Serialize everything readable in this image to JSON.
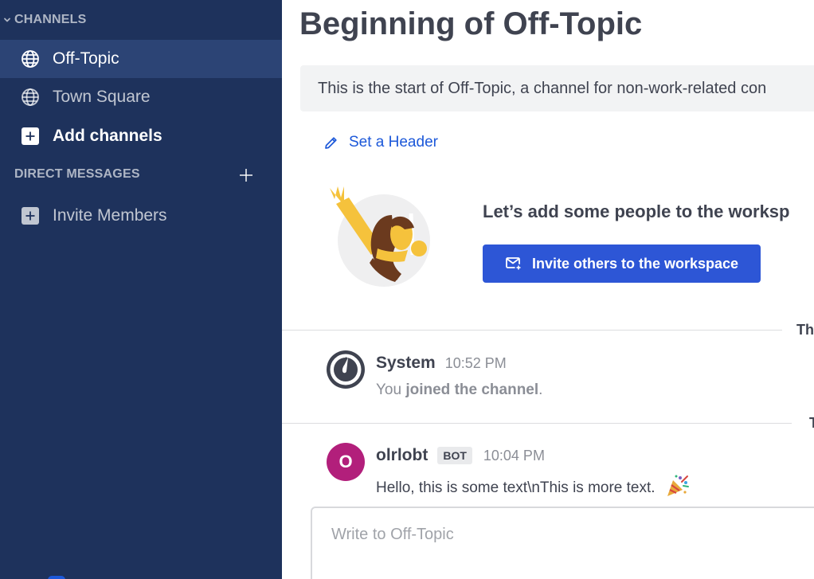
{
  "sidebar": {
    "channels_header": "CHANNELS",
    "channels": [
      {
        "label": "Off-Topic",
        "icon": "globe-icon",
        "active": true
      },
      {
        "label": "Town Square",
        "icon": "globe-icon",
        "active": false
      }
    ],
    "add_channels_label": "Add channels",
    "dm_header": "DIRECT MESSAGES",
    "invite_members_label": "Invite Members"
  },
  "channel": {
    "title": "Beginning of Off-Topic",
    "intro": "This is the start of Off-Topic, a channel for non-work-related con",
    "set_header_label": "Set a Header",
    "add_people_heading": "Let’s add some people to the worksp",
    "invite_button_label": "Invite others to the workspace"
  },
  "separators": [
    "Th",
    "T"
  ],
  "posts": [
    {
      "author": "System",
      "time": "10:52 PM",
      "text_prefix": "You ",
      "text_bold": "joined the channel",
      "text_suffix": "."
    },
    {
      "author": "olrlobt",
      "avatar_letter": "O",
      "badge": "BOT",
      "time": "10:04 PM",
      "text": "Hello, this is some text\\nThis is more text.",
      "emoji": "party-popper-icon"
    }
  ],
  "composer": {
    "placeholder": "Write to Off-Topic"
  },
  "colors": {
    "sidebar_bg": "#1e325c",
    "sidebar_active": "#2c4475",
    "primary": "#2d56d6",
    "link": "#1c58d9",
    "bot_avatar": "#b21f7b"
  }
}
